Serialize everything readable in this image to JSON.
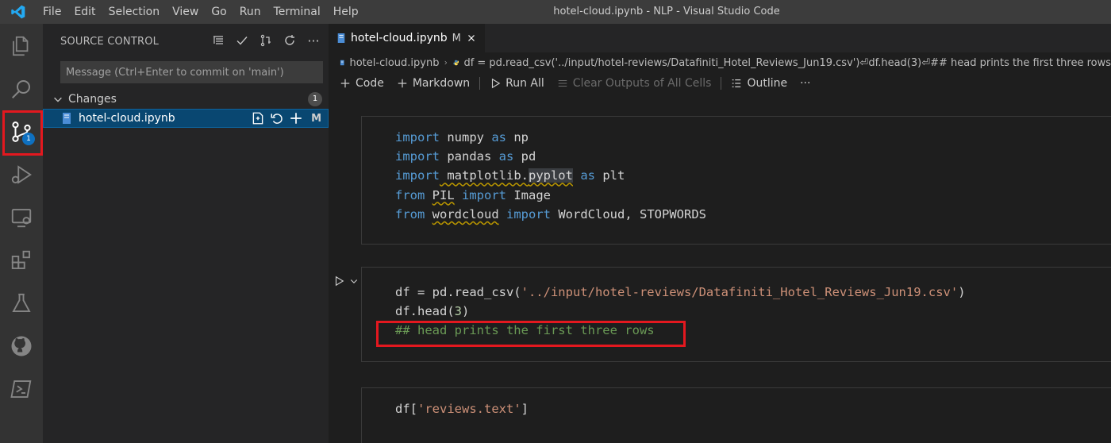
{
  "titlebar": {
    "menu": [
      "File",
      "Edit",
      "Selection",
      "View",
      "Go",
      "Run",
      "Terminal",
      "Help"
    ],
    "title": "hotel-cloud.ipynb - NLP - Visual Studio Code"
  },
  "activity": {
    "scm_badge": "1"
  },
  "sidebar": {
    "header": "SOURCE CONTROL",
    "commit_placeholder": "Message (Ctrl+Enter to commit on 'main')",
    "changes_label": "Changes",
    "changes_count": "1",
    "file_name": "hotel-cloud.ipynb",
    "file_status": "M"
  },
  "editor": {
    "tab_label": "hotel-cloud.ipynb",
    "tab_status": "M",
    "breadcrumb_file": "hotel-cloud.ipynb",
    "breadcrumb_symbol": "df = pd.read_csv('../input/hotel-reviews/Datafiniti_Hotel_Reviews_Jun19.csv')⏎df.head(3)⏎## head prints the first three rows",
    "toolbar": {
      "code": "Code",
      "markdown": "Markdown",
      "run_all": "Run All",
      "clear_outputs": "Clear Outputs of All Cells",
      "outline": "Outline",
      "more": "···"
    }
  },
  "cells": {
    "cell1": {
      "l1_kw": "import",
      "l1_rest": " numpy ",
      "l1_as": "as",
      "l1_alias": " np",
      "l2_kw": "import",
      "l2_rest": " pandas ",
      "l2_as": "as",
      "l2_alias": " pd",
      "l3_kw": "import",
      "l3_mod": " matplotlib.",
      "l3_sub": "pyplot",
      "l3_as": "as",
      "l3_alias": " plt",
      "l4_from": "from",
      "l4_mod": "PIL",
      "l4_imp": "import",
      "l4_name": " Image",
      "l5_from": "from",
      "l5_mod": "wordcloud",
      "l5_imp": "import",
      "l5_name": " WordCloud, STOPWORDS"
    },
    "cell2": {
      "l1_a": "df = pd.read_csv(",
      "l1_str": "'../input/hotel-reviews/Datafiniti_Hotel_Reviews_Jun19.csv'",
      "l1_b": ")",
      "l2_a": "df.head(",
      "l2_num": "3",
      "l2_b": ")",
      "l3_cmt": "## head prints the first three rows"
    },
    "cell3": {
      "l1_a": "df[",
      "l1_str": "'reviews.text'",
      "l1_b": "]"
    }
  },
  "colors": {
    "accent_blue": "#0e70c0",
    "highlight_red": "#e3181f",
    "keyword": "#569cd6",
    "string": "#ce9178",
    "comment": "#6a9955"
  }
}
